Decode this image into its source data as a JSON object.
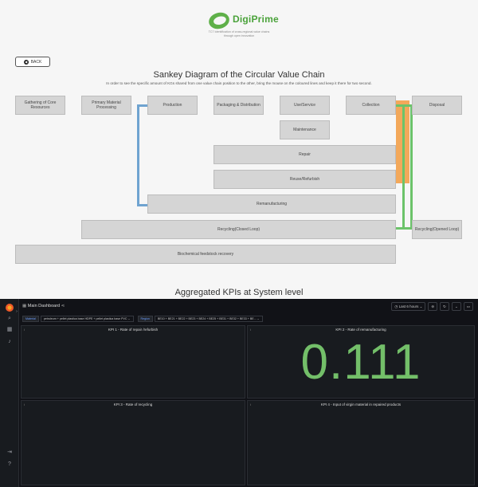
{
  "brand": {
    "name": "DigiPrime",
    "tagline_line1": "TC7 Identification of cross-regional value chains",
    "tagline_line2": "through open innovation"
  },
  "back_label": "BACK",
  "sankey": {
    "title": "Sankey Diagram of the Circular Value Chain",
    "subtitle": "In order to see the specific amount of KGs shared from one value chain position to the other, bring the mouse on the coloured lines and keep it there for two second.",
    "nodes": {
      "gathering": "Gathering of Core Resources",
      "primary": "Primary Material Processing",
      "production": "Production",
      "packaging": "Packaging & Distribution",
      "use": "Use/Service",
      "collection": "Collection",
      "disposal": "Disposal",
      "maintenance": "Maintenance",
      "repair": "Repair",
      "reuse": "Reuse/Refurbish",
      "remanufacturing": "Remanufacturing",
      "recycling_closed": "Recycling(Closed Loop)",
      "recycling_opened": "Recycling(Opened Loop)",
      "biochemical": "Biochemical feedstock recovery"
    },
    "flow_colors": {
      "blue": "#6fa3d0",
      "orange": "#f3a85a",
      "green": "#6cc36a"
    }
  },
  "kpi_section_title": "Aggregated KPIs at System level",
  "dashboard": {
    "title": "Main Dashboard",
    "time_range": "Last 6 hours",
    "variables": [
      {
        "label": "Material",
        "value": "petroleum + pellet plastica base HDPE + pellet plastica base PVC"
      },
      {
        "label": "Region",
        "value": "BE10 + BE21 + BE22 + BE23 + BE24 + BE25 + BE31 + BE32 + BE33 + BE..."
      }
    ],
    "panels": [
      {
        "title": "KPI 1 - Rate of repair /refurbish",
        "info": "i",
        "value": ""
      },
      {
        "title": "KPI 2 - Rate of remanufacturing",
        "info": "i",
        "value": "0.111"
      },
      {
        "title": "KPI 3 - Rate of recycling",
        "info": "i",
        "value": ""
      },
      {
        "title": "KPI 4 - Input of virgin material in repaired products",
        "info": "i",
        "value": ""
      }
    ],
    "value_color": "#73bf69"
  }
}
